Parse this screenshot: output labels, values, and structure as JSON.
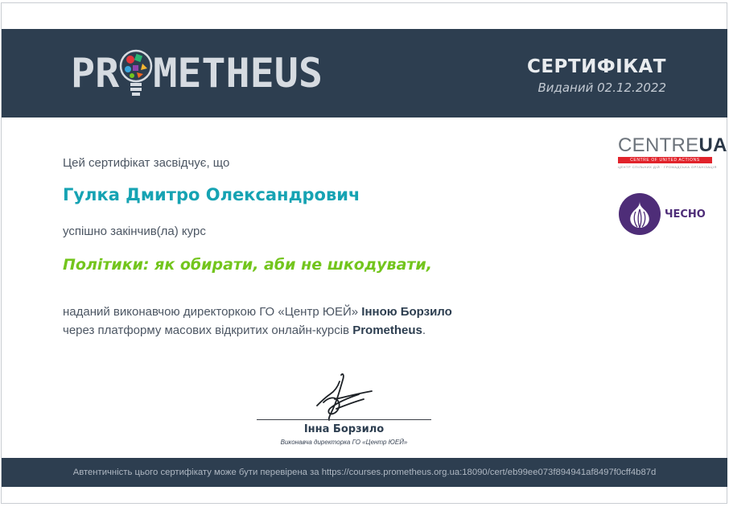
{
  "header": {
    "logo": {
      "left": "PR",
      "right": "METHEUS",
      "bulb_icon": "lightbulb-icon"
    },
    "title": "СЕРТИФІКАТ",
    "issued": "Виданий 02.12.2022"
  },
  "body": {
    "certifies": "Цей сертифікат засвідчує, що",
    "recipient": "Гулка Дмитро Олександрович",
    "completed": "успішно закінчив(ла) курс",
    "course": "Політики: як обирати, аби не шкодувати,",
    "issuer_line1": "наданий виконавчою директоркою ГО «Центр ЮЕЙ» ",
    "issuer_name": "Інною Борзило",
    "issuer_line2": "через платформу масових відкритих онлайн-курсів ",
    "platform": "Prometheus",
    "period": "."
  },
  "partners": {
    "centre": {
      "word_light": "CENTRE",
      "word_bold": "UA",
      "bar_text": "CENTRE OF UNITED ACTIONS",
      "sub_text": "ЦЕНТР СПІЛЬНИХ ДІЙ · ГРОМАДСЬКА ОРГАНІЗАЦІЯ"
    },
    "chesno": {
      "label": "ЧЕСНО",
      "icon": "garlic-icon"
    }
  },
  "signature": {
    "icon": "signature-icon",
    "name": "Інна Борзило",
    "role": "Виконавча директорка ГО «Центр ЮЕЙ»"
  },
  "footer": {
    "text": "Автентичність цього сертифікату може бути перевірена за https://courses.prometheus.org.ua:18090/cert/eb99ee073f894941af8497f0cff4b87d"
  },
  "colors": {
    "header_bg": "#2d3e50",
    "recipient": "#16a3b3",
    "course": "#73c51d",
    "centre_red": "#e1232b",
    "chesno_purple": "#4e2d78"
  }
}
